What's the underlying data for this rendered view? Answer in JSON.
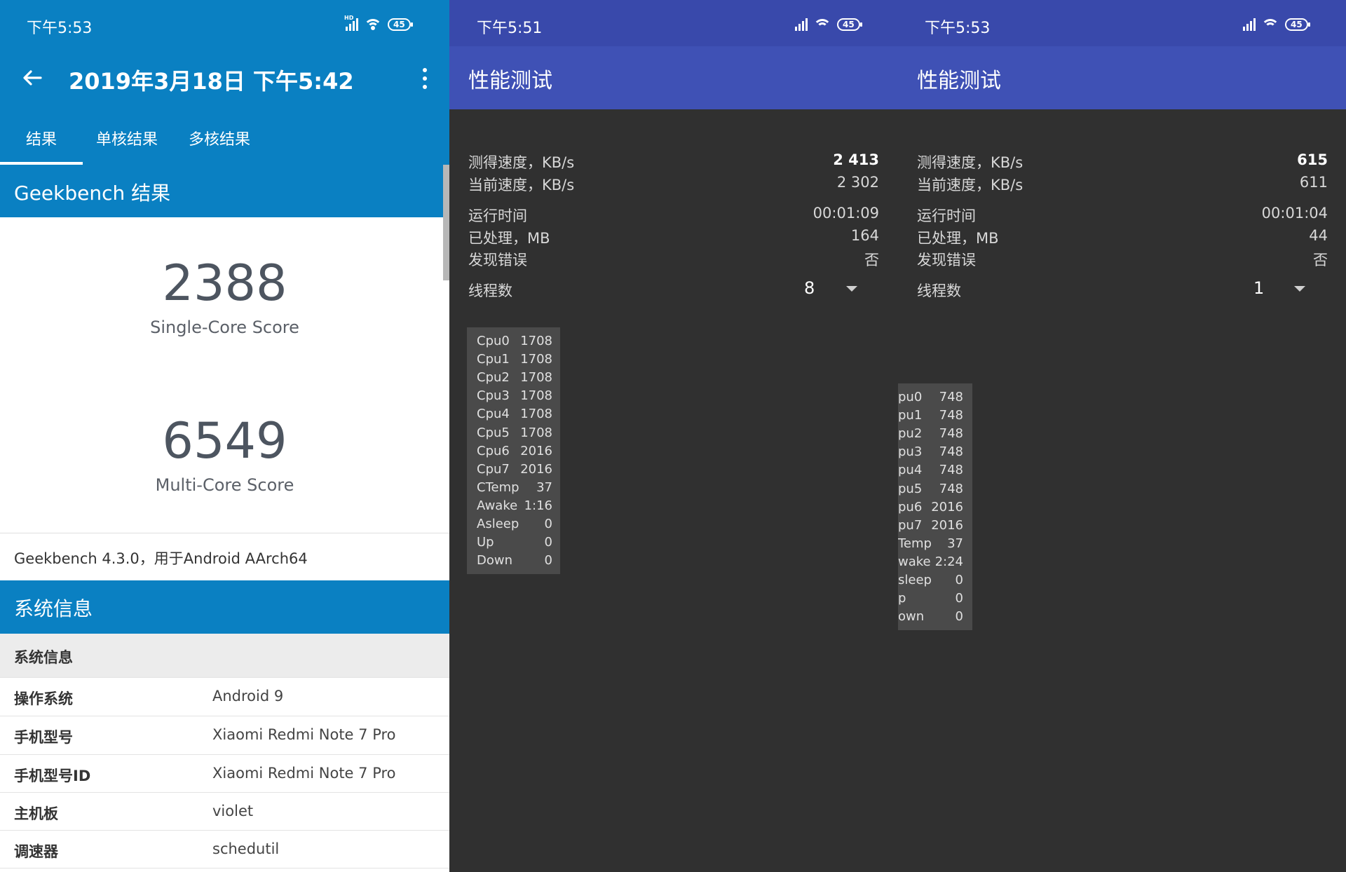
{
  "screen1": {
    "status_time": "下午5:53",
    "battery": "45",
    "title": "2019年3月18日 下午5:42",
    "tabs": [
      "结果",
      "单核结果",
      "多核结果"
    ],
    "section_results": "Geekbench 结果",
    "single_core": {
      "score": "2388",
      "label": "Single-Core Score"
    },
    "multi_core": {
      "score": "6549",
      "label": "Multi-Core Score"
    },
    "version": "Geekbench 4.3.0，用于Android AArch64",
    "section_sysinfo": "系统信息",
    "sysinfo_header": "系统信息",
    "sysinfo": [
      {
        "key": "操作系统",
        "value": "Android 9"
      },
      {
        "key": "手机型号",
        "value": "Xiaomi Redmi Note 7 Pro"
      },
      {
        "key": "手机型号ID",
        "value": "Xiaomi Redmi Note 7 Pro"
      },
      {
        "key": "主机板",
        "value": "violet"
      },
      {
        "key": "调速器",
        "value": "schedutil"
      }
    ]
  },
  "screen2": {
    "status_time": "下午5:51",
    "battery": "45",
    "title": "性能测试",
    "rows": [
      {
        "key": "测得速度，KB/s",
        "value": "2 413"
      },
      {
        "key": "当前速度，KB/s",
        "value": "2 302"
      },
      {
        "key": "运行时间",
        "value": "00:01:09"
      },
      {
        "key": "已处理，MB",
        "value": "164"
      },
      {
        "key": "发现错误",
        "value": "否"
      }
    ],
    "threads_label": "线程数",
    "threads_value": "8",
    "cpu_stats": [
      {
        "k": "Cpu0",
        "v": "1708"
      },
      {
        "k": "Cpu1",
        "v": "1708"
      },
      {
        "k": "Cpu2",
        "v": "1708"
      },
      {
        "k": "Cpu3",
        "v": "1708"
      },
      {
        "k": "Cpu4",
        "v": "1708"
      },
      {
        "k": "Cpu5",
        "v": "1708"
      },
      {
        "k": "Cpu6",
        "v": "2016"
      },
      {
        "k": "Cpu7",
        "v": "2016"
      },
      {
        "k": "CTemp",
        "v": "37"
      },
      {
        "k": "Awake",
        "v": "1:16"
      },
      {
        "k": "Asleep",
        "v": "0"
      },
      {
        "k": "Up",
        "v": "0"
      },
      {
        "k": "Down",
        "v": "0"
      }
    ]
  },
  "screen3": {
    "status_time": "下午5:53",
    "battery": "45",
    "title": "性能测试",
    "rows": [
      {
        "key": "测得速度，KB/s",
        "value": "615"
      },
      {
        "key": "当前速度，KB/s",
        "value": "611"
      },
      {
        "key": "运行时间",
        "value": "00:01:04"
      },
      {
        "key": "已处理，MB",
        "value": "44"
      },
      {
        "key": "发现错误",
        "value": "否"
      }
    ],
    "threads_label": "线程数",
    "threads_value": "1",
    "cpu_stats": [
      {
        "k": "pu0",
        "v": "748"
      },
      {
        "k": "pu1",
        "v": "748"
      },
      {
        "k": "pu2",
        "v": "748"
      },
      {
        "k": "pu3",
        "v": "748"
      },
      {
        "k": "pu4",
        "v": "748"
      },
      {
        "k": "pu5",
        "v": "748"
      },
      {
        "k": "pu6",
        "v": "2016"
      },
      {
        "k": "pu7",
        "v": "2016"
      },
      {
        "k": "Temp",
        "v": "37"
      },
      {
        "k": "wake",
        "v": "2:24"
      },
      {
        "k": "sleep",
        "v": "0"
      },
      {
        "k": "p",
        "v": "0"
      },
      {
        "k": "own",
        "v": "0"
      }
    ]
  },
  "colors": {
    "geekbench_blue": "#0a80c2",
    "indigo_status": "#3949ab",
    "indigo_appbar": "#3f51b5",
    "dark_bg": "#303030"
  }
}
